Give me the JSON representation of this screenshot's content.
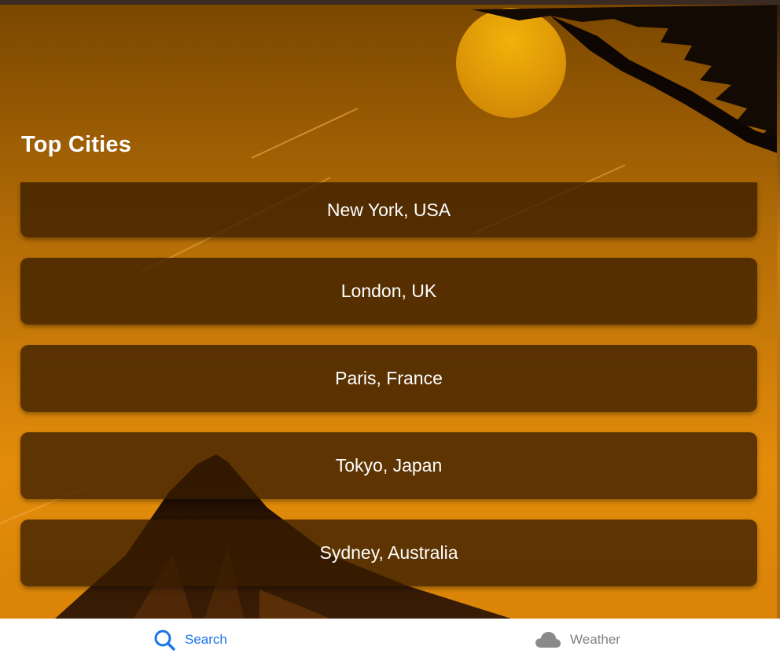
{
  "main": {
    "section_title": "Top Cities",
    "cities": [
      {
        "label": "New York, USA"
      },
      {
        "label": "London, UK"
      },
      {
        "label": "Paris, France"
      },
      {
        "label": "Tokyo, Japan"
      },
      {
        "label": "Sydney, Australia"
      }
    ]
  },
  "bottom_nav": {
    "items": [
      {
        "label": "Search",
        "icon": "search-icon",
        "active": true,
        "color": "#1a73e8"
      },
      {
        "label": "Weather",
        "icon": "cloud-icon",
        "active": false,
        "color": "#808080"
      }
    ]
  },
  "theme": {
    "background_accent": "#e08a0a",
    "card_color": "#3a1f00",
    "text_color": "#ffffff"
  }
}
